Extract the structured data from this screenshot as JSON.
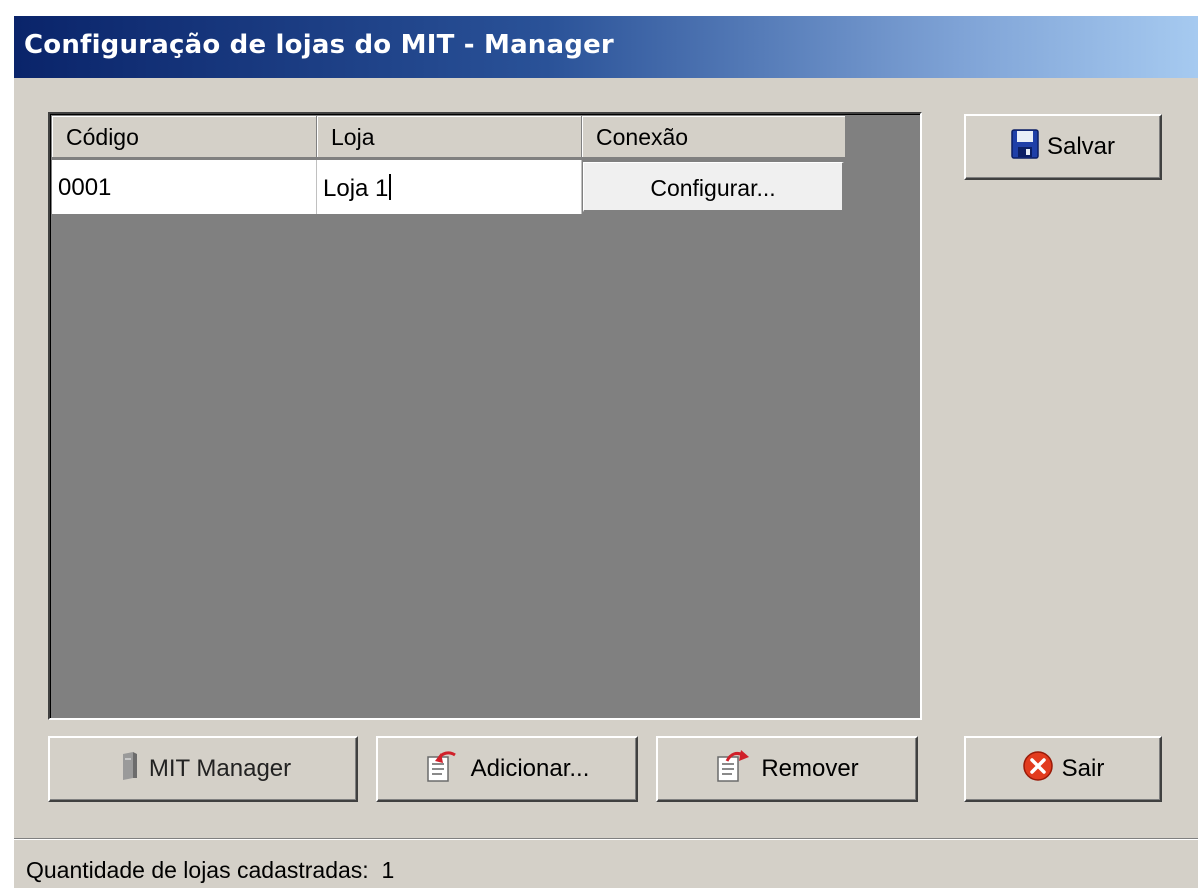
{
  "window": {
    "title": "Configuração de lojas do MIT - Manager"
  },
  "grid": {
    "columns": [
      "Código",
      "Loja",
      "Conexão"
    ],
    "rows": [
      {
        "codigo": "0001",
        "loja": "Loja 1",
        "conexao_button": "Configurar..."
      }
    ]
  },
  "buttons": {
    "salvar": "Salvar",
    "mit_manager": "MIT Manager",
    "adicionar": "Adicionar...",
    "remover": "Remover",
    "sair": "Sair"
  },
  "status": {
    "label": "Quantidade de lojas cadastradas:",
    "count": "1"
  },
  "icons": {
    "salvar": "floppy-disk-icon",
    "mit_manager": "server-icon",
    "adicionar": "add-document-icon",
    "remover": "remove-document-icon",
    "sair": "close-circle-icon"
  },
  "colors": {
    "title_gradient_start": "#0a246a",
    "title_gradient_end": "#a6caf0",
    "window_bg": "#d4d0c8",
    "grid_bg": "#808080",
    "sair_icon": "#e23b1e",
    "save_icon": "#1f3fa8"
  }
}
